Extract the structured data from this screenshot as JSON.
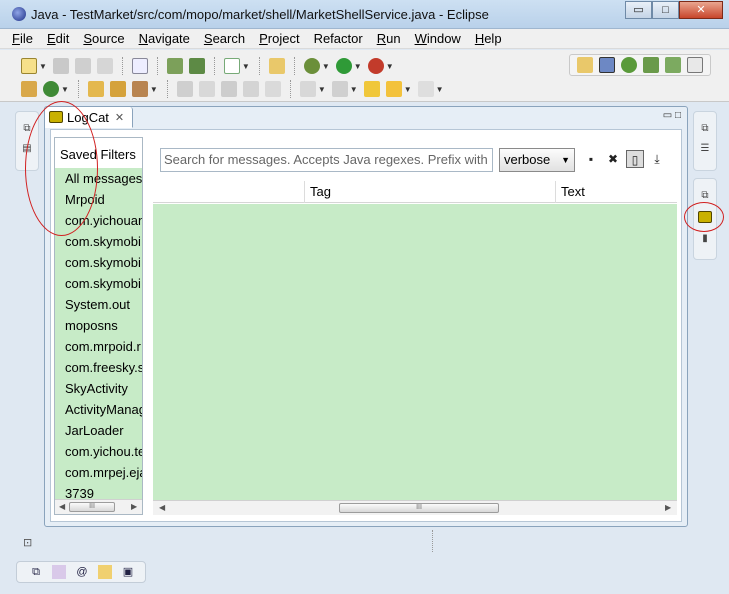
{
  "window": {
    "title": "Java - TestMarket/src/com/mopo/market/shell/MarketShellService.java - Eclipse",
    "controls": {
      "minimize": "▭",
      "maximize": "□",
      "close": "✕"
    }
  },
  "menu": [
    {
      "underline": "F",
      "rest": "ile"
    },
    {
      "underline": "E",
      "rest": "dit"
    },
    {
      "underline": "S",
      "rest": "ource"
    },
    {
      "underline": "N",
      "rest": "avigate"
    },
    {
      "underline": "S",
      "rest": "earch"
    },
    {
      "underline": "P",
      "rest": "roject"
    },
    {
      "underline": "",
      "rest": "Refactor"
    },
    {
      "underline": "R",
      "rest": "un"
    },
    {
      "underline": "W",
      "rest": "indow"
    },
    {
      "underline": "H",
      "rest": "elp"
    }
  ],
  "logcat_view": {
    "tab_label": "LogCat",
    "tab_close": "✕",
    "minimize": "▭",
    "maximize": "□",
    "saved_filters_title": "Saved Filters",
    "filters": [
      "All messages",
      "Mrpoid",
      "com.yichouan",
      "com.skymobi",
      "com.skymobi",
      "com.skymobi",
      "System.out",
      "moposns",
      "com.mrpoid.r",
      "com.freesky.s",
      "SkyActivity",
      "ActivityManag",
      "JarLoader",
      "com.yichou.te",
      "com.mrpej.eja",
      "3739"
    ],
    "search_placeholder": "Search for messages. Accepts Java regexes. Prefix with p",
    "log_level": "verbose",
    "columns": [
      "",
      "Tag",
      "Text"
    ],
    "scroll_thumb": "III"
  },
  "colors": {
    "list_background": "#c7ebc7",
    "annotation": "#d12020",
    "title_gradient_top": "#cde0f2"
  }
}
